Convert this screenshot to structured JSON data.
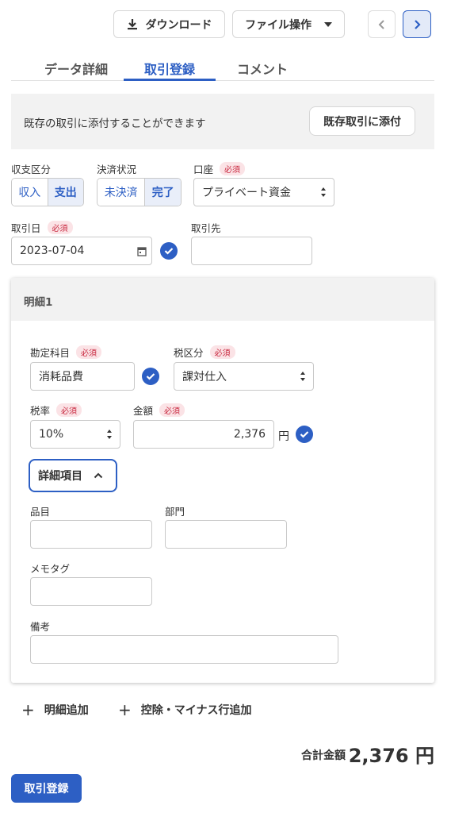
{
  "toolbar": {
    "download_label": "ダウンロード",
    "file_ops_label": "ファイル操作"
  },
  "tabs": [
    {
      "label": "データ詳細",
      "active": false
    },
    {
      "label": "取引登録",
      "active": true
    },
    {
      "label": "コメント",
      "active": false
    }
  ],
  "notice": {
    "text": "既存の取引に添付することができます",
    "button_label": "既存取引に添付"
  },
  "required_badge": "必須",
  "form": {
    "income_expense": {
      "label": "収支区分",
      "options": [
        "収入",
        "支出"
      ],
      "selected": "支出"
    },
    "settlement": {
      "label": "決済状況",
      "options": [
        "未決済",
        "完了"
      ],
      "selected": "完了"
    },
    "account": {
      "label": "口座",
      "value": "プライベート資金"
    },
    "date": {
      "label": "取引日",
      "value": "2023-07-04"
    },
    "partner": {
      "label": "取引先",
      "value": ""
    }
  },
  "line_item": {
    "title": "明細1",
    "account_item": {
      "label": "勘定科目",
      "value": "消耗品費"
    },
    "tax_category": {
      "label": "税区分",
      "value": "課対仕入"
    },
    "tax_rate": {
      "label": "税率",
      "value": "10%"
    },
    "amount": {
      "label": "金額",
      "value": "2,376",
      "unit": "円"
    },
    "details_toggle_label": "詳細項目",
    "item": {
      "label": "品目",
      "value": ""
    },
    "department": {
      "label": "部門",
      "value": ""
    },
    "memo_tag": {
      "label": "メモタグ",
      "value": ""
    },
    "remarks": {
      "label": "備考",
      "value": ""
    }
  },
  "actions": {
    "add_line_label": "明細追加",
    "add_deduction_label": "控除・マイナス行追加"
  },
  "total": {
    "label": "合計金額",
    "value": "2,376 円"
  },
  "submit_label": "取引登録",
  "colors": {
    "accent": "#2d5fc4",
    "required_bg": "#fbe3e6",
    "required_text": "#c8283f",
    "panel_bg": "#f2f2f2"
  }
}
